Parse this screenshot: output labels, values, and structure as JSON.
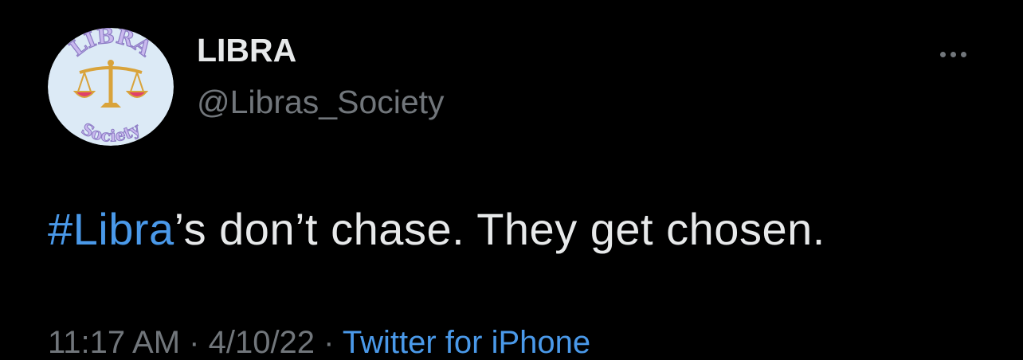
{
  "tweet": {
    "author": {
      "display_name": "LIBRA",
      "handle": "@Libras_Society",
      "avatar_arc_top": "LIBRA",
      "avatar_arc_bottom": "Society"
    },
    "more_icon": "more-horizontal-icon",
    "text": {
      "hashtag": "#Libra",
      "rest": "’s don’t chase. They get chosen."
    },
    "meta": {
      "time": "11:17 AM",
      "separator": " · ",
      "date": "4/10/22",
      "source": "Twitter for iPhone"
    }
  },
  "colors": {
    "background": "#000000",
    "primary_text": "#e7e9ea",
    "secondary_text": "#71767b",
    "link": "#4a99e9",
    "avatar_bg": "#dceaf6",
    "avatar_lettering": "#c9b8ee",
    "scale_gold": "#d9a33a",
    "scale_pan": "#e0406a"
  }
}
